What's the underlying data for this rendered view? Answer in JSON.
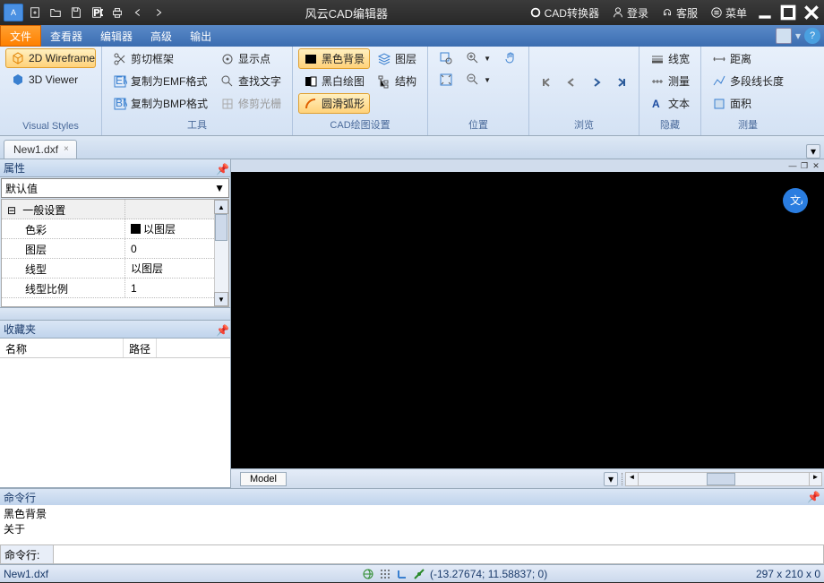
{
  "title": "风云CAD编辑器",
  "titlebar_right": {
    "converter": "CAD转换器",
    "login": "登录",
    "support": "客服",
    "menu": "菜单"
  },
  "menus": {
    "file": "文件",
    "viewer": "查看器",
    "editor": "编辑器",
    "advanced": "高级",
    "output": "输出"
  },
  "ribbon": {
    "visual_styles": {
      "wireframe": "2D Wireframe",
      "viewer3d": "3D Viewer",
      "label": "Visual Styles"
    },
    "tools": {
      "clip_frame": "剪切框架",
      "copy_emf": "复制为EMF格式",
      "copy_bmp": "复制为BMP格式",
      "show_point": "显示点",
      "find_text": "查找文字",
      "trim_raster": "修剪光栅",
      "label": "工具"
    },
    "cad_settings": {
      "black_bg": "黑色背景",
      "mono": "黑白绘图",
      "smooth_arc": "圆滑弧形",
      "layers": "图层",
      "structure": "结构",
      "label": "CAD绘图设置"
    },
    "position": {
      "label": "位置"
    },
    "browse": {
      "label": "浏览"
    },
    "hide": {
      "linewidth": "线宽",
      "measure": "测量",
      "text": "文本",
      "label": "隐藏"
    },
    "measure": {
      "distance": "距离",
      "polylength": "多段线长度",
      "area": "面积",
      "label": "测量"
    }
  },
  "filetab": "New1.dxf",
  "properties": {
    "title": "属性",
    "combo": "默认值",
    "group": "一般设置",
    "rows": {
      "color_k": "色彩",
      "color_v": "以图层",
      "layer_k": "图层",
      "layer_v": "0",
      "ltype_k": "线型",
      "ltype_v": "以图层",
      "lscale_k": "线型比例",
      "lscale_v": "1"
    }
  },
  "favorites": {
    "title": "收藏夹",
    "col_name": "名称",
    "col_path": "路径"
  },
  "model_tab": "Model",
  "command": {
    "title": "命令行",
    "lines": {
      "l1": "黑色背景",
      "l2": "关于"
    },
    "prompt": "命令行:"
  },
  "status": {
    "file": "New1.dxf",
    "coords": "(-13.27674; 11.58837; 0)",
    "dims": "297 x 210 x 0"
  }
}
